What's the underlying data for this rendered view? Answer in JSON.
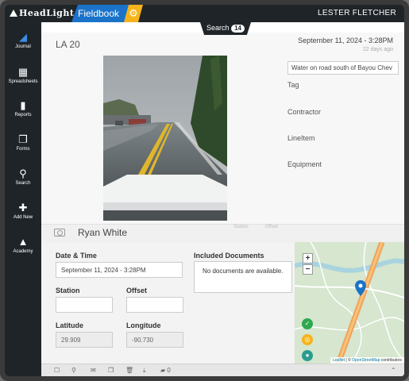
{
  "app": {
    "logo": "HeadLight",
    "module": "Fieldbook",
    "user": "LESTER FLETCHER",
    "search_label": "Search",
    "search_count": "14"
  },
  "sidebar": {
    "items": [
      {
        "label": "Journal",
        "icon": "binoculars-icon",
        "active": true
      },
      {
        "label": "Spreadsheets",
        "icon": "grid-icon"
      },
      {
        "label": "Reports",
        "icon": "book-icon"
      },
      {
        "label": "Forms",
        "icon": "copy-icon"
      },
      {
        "label": "Search",
        "icon": "magnifier-icon"
      },
      {
        "label": "Add New",
        "icon": "plus-icon"
      },
      {
        "label": "Academy",
        "icon": "graduation-cap-icon"
      }
    ]
  },
  "record": {
    "title": "LA 20",
    "date": "September 11, 2024 - 3:28PM",
    "ago": "22 days ago",
    "description": "Water on road south of Bayou Chev",
    "side_labels": [
      "Tag",
      "Contractor",
      "LineItem",
      "Equipment"
    ],
    "author": "Ryan White",
    "station_label": "Station",
    "offset_label": "Offset"
  },
  "form": {
    "datetime_label": "Date & Time",
    "datetime_value": "September 11, 2024 - 3:28PM",
    "station_label": "Station",
    "station_value": "",
    "offset_label": "Offset",
    "offset_value": "",
    "latitude_label": "Latitude",
    "latitude_value": "29.909",
    "longitude_label": "Longitude",
    "longitude_value": "-90.730",
    "docs_label": "Included Documents",
    "docs_empty": "No documents are available."
  },
  "map": {
    "zoom_in": "+",
    "zoom_out": "−",
    "attribution_leaflet": "Leaflet",
    "attribution_sep": " | © ",
    "attribution_osm": "OpenStreetMap",
    "attribution_suffix": " contributors"
  },
  "toolbar": {
    "doc_count": "0"
  },
  "colors": {
    "accent_blue": "#1a73c9",
    "accent_yellow": "#f5b31c",
    "dark": "#1f2428",
    "map_pin": "#1a73c9"
  }
}
